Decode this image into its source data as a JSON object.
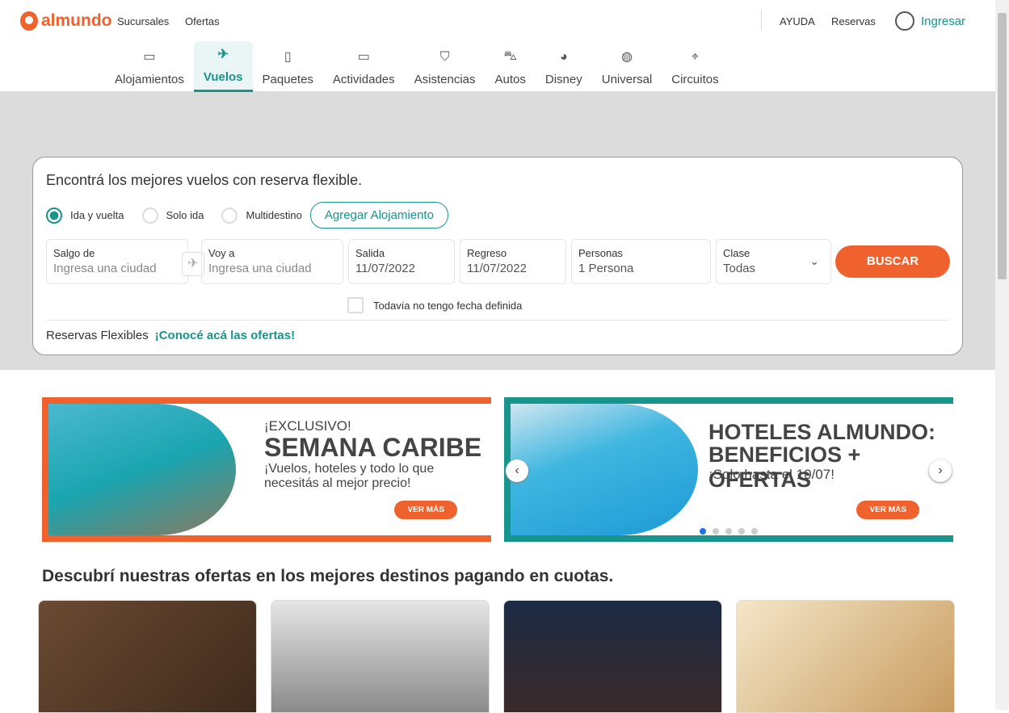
{
  "header": {
    "brand": "almundo",
    "links": [
      "Sucursales",
      "Ofertas"
    ],
    "help": "AYUDA",
    "bookings": "Reservas",
    "login": "Ingresar"
  },
  "nav": [
    {
      "label": "Alojamientos",
      "icon": "bed-icon"
    },
    {
      "label": "Vuelos",
      "icon": "plane-icon",
      "active": true
    },
    {
      "label": "Paquetes",
      "icon": "luggage-icon"
    },
    {
      "label": "Actividades",
      "icon": "ticket-icon"
    },
    {
      "label": "Asistencias",
      "icon": "shield-icon"
    },
    {
      "label": "Autos",
      "icon": "car-icon"
    },
    {
      "label": "Disney",
      "icon": "mickey-icon"
    },
    {
      "label": "Universal",
      "icon": "universal-globe-icon"
    },
    {
      "label": "Circuitos",
      "icon": "map-pins-icon"
    }
  ],
  "search": {
    "title": "Encontrá los mejores vuelos con reserva flexible.",
    "trip_types": [
      "Ida y vuelta",
      "Solo ida",
      "Multidestino"
    ],
    "selected_trip": "Ida y vuelta",
    "add_hotel": "Agregar Alojamiento",
    "from": {
      "label": "Salgo de",
      "placeholder": "Ingresa una ciudad"
    },
    "to": {
      "label": "Voy a",
      "placeholder": "Ingresa una ciudad"
    },
    "depart": {
      "label": "Salida",
      "value": "11/07/2022"
    },
    "return": {
      "label": "Regreso",
      "value": "11/07/2022"
    },
    "people": {
      "label": "Personas",
      "value": "1 Persona"
    },
    "class": {
      "label": "Clase",
      "value": "Todas"
    },
    "search_button": "BUSCAR",
    "no_date": "Todavía no tengo fecha definida",
    "flex_label": "Reservas Flexibles",
    "flex_link": "¡Conocé acá las ofertas!"
  },
  "banners": [
    {
      "kicker": "¡EXCLUSIVO!",
      "title": "SEMANA CARIBE",
      "text": "¡Vuelos, hoteles y todo lo que necesitás al mejor precio!",
      "cta": "VER MÁS"
    },
    {
      "title": "HOTELES ALMUNDO:",
      "title2": "BENEFICIOS + OFERTAS",
      "text": "¡Solo hasta el 10/07!",
      "cta": "VER MÁS"
    }
  ],
  "section_title": "Descubrí nuestras ofertas en los mejores destinos pagando en cuotas.",
  "colors": {
    "brand": "#f0622d",
    "accent": "#17948c"
  }
}
